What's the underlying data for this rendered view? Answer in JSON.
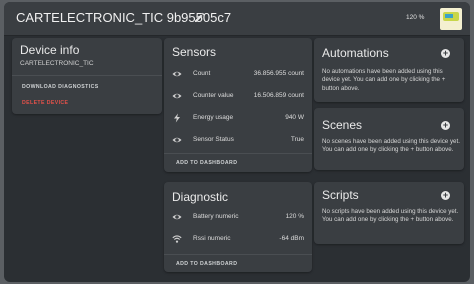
{
  "header": {
    "title": "CARTELECTRONIC_TIC 9b95505c7",
    "battery": "120 %"
  },
  "device_info": {
    "title": "Device info",
    "name": "CARTELECTRONIC_TIC",
    "download": "DOWNLOAD DIAGNOSTICS",
    "delete": "DELETE DEVICE"
  },
  "sensors": {
    "title": "Sensors",
    "rows": [
      {
        "name": "Count",
        "value": "36.856.955 count",
        "icon": "eye-icon"
      },
      {
        "name": "Counter value",
        "value": "16.506.859 count",
        "icon": "eye-icon"
      },
      {
        "name": "Energy usage",
        "value": "940 W",
        "icon": "flash-icon"
      },
      {
        "name": "Sensor Status",
        "value": "True",
        "icon": "eye-icon"
      }
    ],
    "add": "ADD TO DASHBOARD"
  },
  "diagnostic": {
    "title": "Diagnostic",
    "rows": [
      {
        "name": "Battery numeric",
        "value": "120 %",
        "icon": "eye-icon"
      },
      {
        "name": "Rssi numeric",
        "value": "-64 dBm",
        "icon": "wifi-icon"
      }
    ],
    "add": "ADD TO DASHBOARD"
  },
  "automations": {
    "title": "Automations",
    "text": "No automations have been added using this device yet. You can add one by clicking the + button above."
  },
  "scenes": {
    "title": "Scenes",
    "text": "No scenes have been added using this device yet. You can add one by clicking the + button above."
  },
  "scripts": {
    "title": "Scripts",
    "text": "No scripts have been added using this device yet. You can add one by clicking the + button above."
  },
  "colors": {
    "background": "#2b2f33",
    "card": "#3a3e42",
    "danger": "#e3514a"
  }
}
